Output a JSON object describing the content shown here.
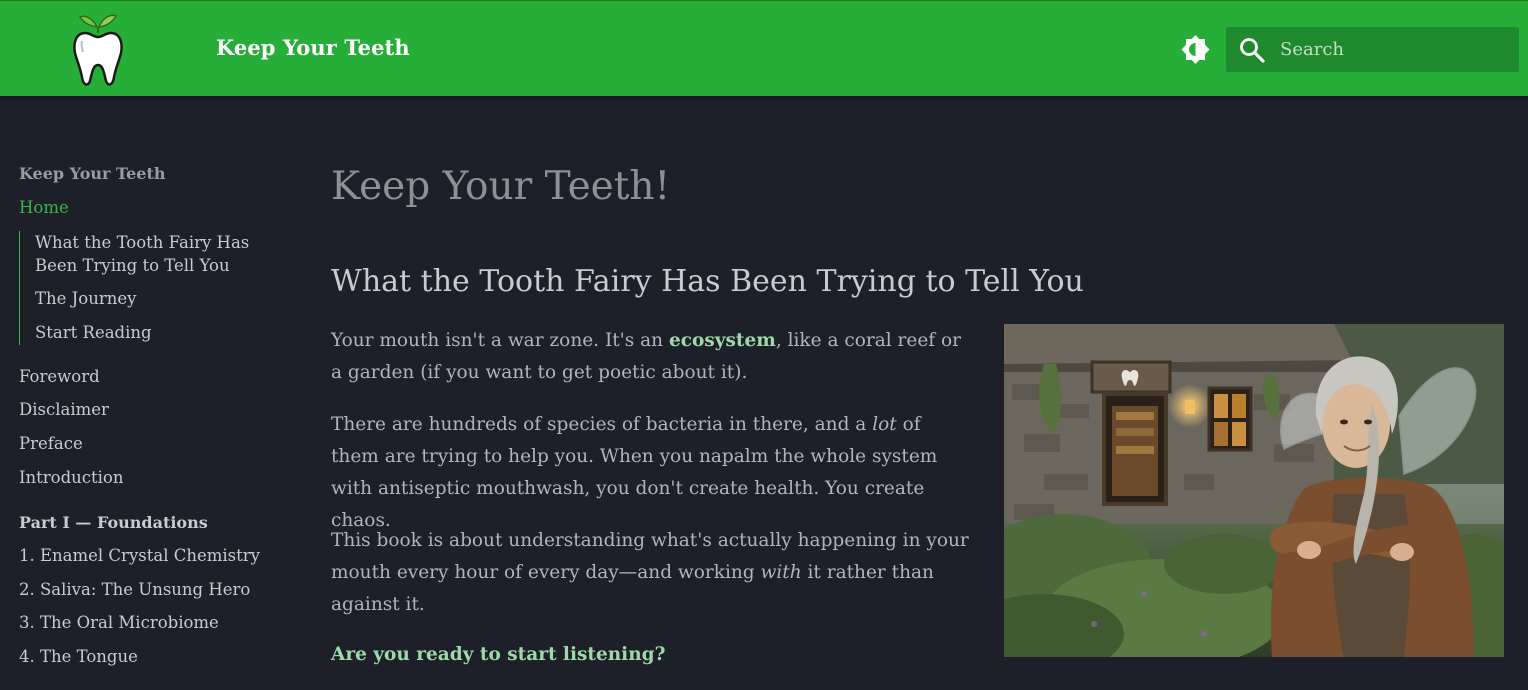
{
  "header": {
    "site_title": "Keep Your Teeth",
    "search_placeholder": "Search",
    "brand_color": "#27ae38",
    "icons": {
      "logo": "tooth-logo-icon",
      "theme": "brightness-icon",
      "search": "search-icon"
    }
  },
  "sidebar": {
    "site_title": "Keep Your Teeth",
    "home": "Home",
    "home_sub": [
      "What the Tooth Fairy Has Been Trying to Tell You",
      "The Journey",
      "Start Reading"
    ],
    "items": [
      "Foreword",
      "Disclaimer",
      "Preface",
      "Introduction"
    ],
    "part1_title": "Part I — Foundations",
    "part1_items": [
      "1. Enamel Crystal Chemistry",
      "2. Saliva: The Unsung Hero",
      "3. The Oral Microbiome",
      "4. The Tongue"
    ],
    "accent_color": "#35b648"
  },
  "main": {
    "title": "Keep Your Teeth!",
    "section_title": "What the Tooth Fairy Has Been Trying to Tell You",
    "p1": {
      "before": "Your mouth isn't a war zone. It's an ",
      "link": "ecosystem",
      "after": ", like a coral reef or a garden (if you want to get poetic about it)."
    },
    "p2": {
      "before": "There are hundreds of species of bacteria in there, and a ",
      "em": "lot",
      "after": " of them are trying to help you. When you napalm the whole system with antiseptic mouthwash, you don't create health. You create chaos."
    },
    "p3": {
      "before": "This book is about understanding what's actually happening in your mouth every hour of every day—and working ",
      "em": "with",
      "after": " it rather than against it."
    },
    "cta": "Are you ready to start listening?",
    "link_color": "#9fd8aa"
  }
}
